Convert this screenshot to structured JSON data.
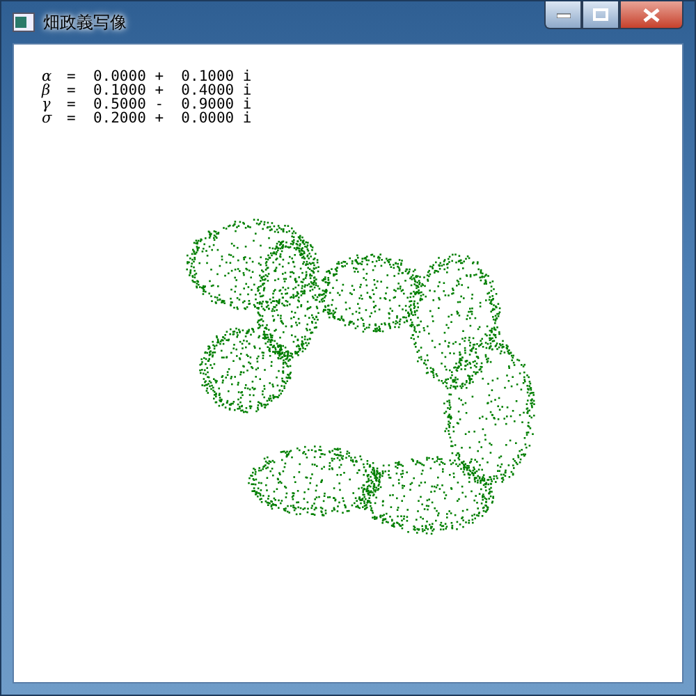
{
  "window": {
    "title": "畑政義写像",
    "controls": [
      {
        "kind": "minimize"
      },
      {
        "kind": "maximize"
      },
      {
        "kind": "close"
      }
    ]
  },
  "parameters": [
    {
      "symbol": "α",
      "value": "=  0.0000 +  0.1000 i"
    },
    {
      "symbol": "β",
      "value": "=  0.1000 +  0.4000 i"
    },
    {
      "symbol": "γ",
      "value": "=  0.5000 -  0.9000 i"
    },
    {
      "symbol": "σ",
      "value": "=  0.2000 +  0.0000 i"
    }
  ]
}
